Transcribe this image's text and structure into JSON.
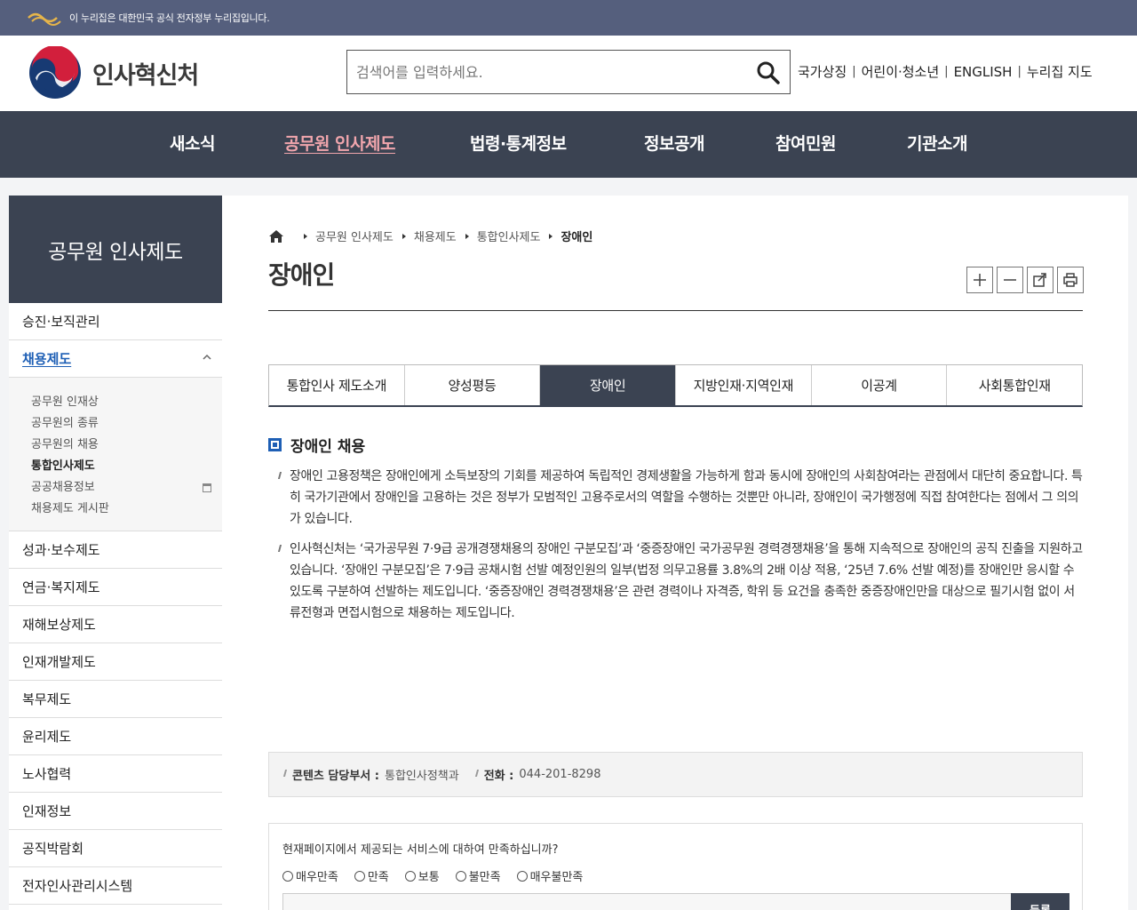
{
  "gov_strip": {
    "text": "이 누리집은 대한민국 공식 전자정부 누리집입니다."
  },
  "header": {
    "logo_text": "인사혁신처",
    "search_placeholder": "검색어를 입력하세요.",
    "util_links": [
      "국가상징",
      "어린이·청소년",
      "ENGLISH",
      "누리집 지도"
    ]
  },
  "gnb": {
    "items": [
      "새소식",
      "공무원 인사제도",
      "법령·통계정보",
      "정보공개",
      "참여민원",
      "기관소개"
    ],
    "active_index": 1
  },
  "lnb": {
    "title": "공무원 인사제도",
    "items_top": [
      "승진·보직관리",
      "채용제도"
    ],
    "sub_items": [
      "공무원 인재상",
      "공무원의 종류",
      "공무원의 채용",
      "통합인사제도",
      "공공채용정보",
      "채용제도 게시판"
    ],
    "items_bottom": [
      "성과·보수제도",
      "연금·복지제도",
      "재해보상제도",
      "인재개발제도",
      "복무제도",
      "윤리제도",
      "노사협력",
      "인재정보",
      "공직박람회",
      "전자인사관리시스템"
    ]
  },
  "breadcrumb": [
    "공무원 인사제도",
    "채용제도",
    "통합인사제도",
    "장애인"
  ],
  "page_title": "장애인",
  "tabs": [
    "통합인사 제도소개",
    "양성평등",
    "장애인",
    "지방인재·지역인재",
    "이공계",
    "사회통합인재"
  ],
  "section": {
    "title": "장애인 채용",
    "paragraphs": [
      "장애인 고용정책은 장애인에게 소득보장의 기회를 제공하여 독립적인 경제생활을 가능하게 함과 동시에 장애인의 사회참여라는 관점에서 대단히 중요합니다. 특히 국가기관에서 장애인을 고용하는 것은 정부가 모범적인 고용주로서의 역할을 수행하는 것뿐만 아니라, 장애인이 국가행정에 직접 참여한다는 점에서 그 의의가 있습니다.",
      "인사혁신처는 ‘국가공무원 7·9급 공개경쟁채용의 장애인 구분모집’과 ‘중증장애인 국가공무원 경력경쟁채용’을 통해 지속적으로 장애인의 공직 진출을 지원하고 있습니다. ‘장애인 구분모집’은 7·9급 공채시험 선발 예정인원의 일부(법정 의무고용률 3.8%의 2배 이상 적용, ‘25년 7.6% 선발 예정)를 장애인만 응시할 수 있도록 구분하여 선발하는 제도입니다. ‘중증장애인 경력경쟁채용’은 관련 경력이나 자격증, 학위 등 요건을 충족한 중증장애인만을 대상으로 필기시험 없이 서류전형과 면접시험으로 채용하는 제도입니다."
    ]
  },
  "info": {
    "dept_label": "콘텐츠 담당부서 :",
    "dept_value": "통합인사정책과",
    "phone_label": "전화 :",
    "phone_value": "044-201-8298"
  },
  "survey": {
    "question": "현재페이지에서 제공되는 서비스에 대하여 만족하십니까?",
    "options": [
      "매우만족",
      "만족",
      "보통",
      "불만족",
      "매우불만족"
    ],
    "submit_label": "등록"
  },
  "colors": {
    "nav_bg": "#3b4352",
    "accent_blue": "#1e5fb5",
    "gnb_active": "#f1a6ad"
  }
}
